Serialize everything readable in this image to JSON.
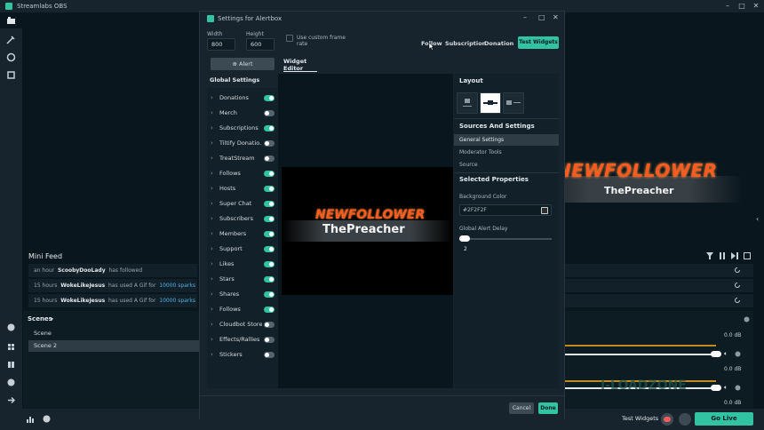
{
  "app": {
    "title": "Streamlabs OBS"
  },
  "modal": {
    "title": "Settings for Alertbox",
    "width_label": "Width",
    "width_value": "800",
    "height_label": "Height",
    "height_value": "600",
    "custom_frame_rate_label_1": "Use custom frame",
    "custom_frame_rate_label_2": "rate",
    "top_tabs": [
      "Follow",
      "Subscription",
      "Donation"
    ],
    "test_widgets_label": "Test Widgets",
    "alert_button_label": "Alert",
    "global_settings_label": "Global Settings",
    "alerts": [
      {
        "name": "Donations",
        "on": true
      },
      {
        "name": "Merch",
        "on": false
      },
      {
        "name": "Subscriptions",
        "on": true
      },
      {
        "name": "Tiltify Donatio...",
        "on": false
      },
      {
        "name": "TreatStream",
        "on": false
      },
      {
        "name": "Follows",
        "on": true
      },
      {
        "name": "Hosts",
        "on": true
      },
      {
        "name": "Super Chat",
        "on": true
      },
      {
        "name": "Subscribers",
        "on": true
      },
      {
        "name": "Members",
        "on": true
      },
      {
        "name": "Support",
        "on": true
      },
      {
        "name": "Likes",
        "on": true
      },
      {
        "name": "Stars",
        "on": true
      },
      {
        "name": "Shares",
        "on": true
      },
      {
        "name": "Follows",
        "on": true
      },
      {
        "name": "Cloudbot Store",
        "on": false
      },
      {
        "name": "Effects/Rallies",
        "on": false
      },
      {
        "name": "Stickers",
        "on": false
      }
    ],
    "editor_tab_label": "Widget Editor",
    "preview_title": "NEWFOLLOWER",
    "preview_name": "ThePreacher",
    "layout_heading": "Layout",
    "sources_heading": "Sources And Settings",
    "sources_items": [
      "General Settings",
      "Moderator Tools",
      "Source"
    ],
    "selected_props_heading": "Selected Properties",
    "bg_color_label": "Background Color",
    "bg_color_value": "#2F2F2F",
    "delay_label": "Global Alert Delay",
    "delay_value": "2",
    "cancel_label": "Cancel",
    "done_label": "Done"
  },
  "mini_feed": {
    "title": "Mini Feed",
    "rows": [
      {
        "time": "an hour",
        "user": "ScoobyDooLady",
        "text": "has followed",
        "link": ""
      },
      {
        "time": "15 hours",
        "user": "WokeLikeJesus",
        "text": "has used A Gif for",
        "link": "10000 sparks"
      },
      {
        "time": "15 hours",
        "user": "WokeLikeJesus",
        "text": "has used A Gif for",
        "link": "10000 sparks"
      }
    ]
  },
  "scenes": {
    "title": "Scenes",
    "items": [
      "Scene",
      "Scene 2"
    ]
  },
  "mixer": {
    "db_values": [
      "0.0 dB",
      "0.0 dB",
      "0.0 dB"
    ]
  },
  "overlay": {
    "title": "NEWFOLLOWER",
    "name": "ThePreacher",
    "watermark": "I-LOADZONE"
  },
  "bottom": {
    "test_widgets_label": "Test Widgets",
    "go_live_label": "Go Live"
  },
  "colors": {
    "accent": "#31c3a2",
    "background": "#09161d",
    "panel": "#17242d",
    "alert_orange": "#ff5a1f"
  }
}
